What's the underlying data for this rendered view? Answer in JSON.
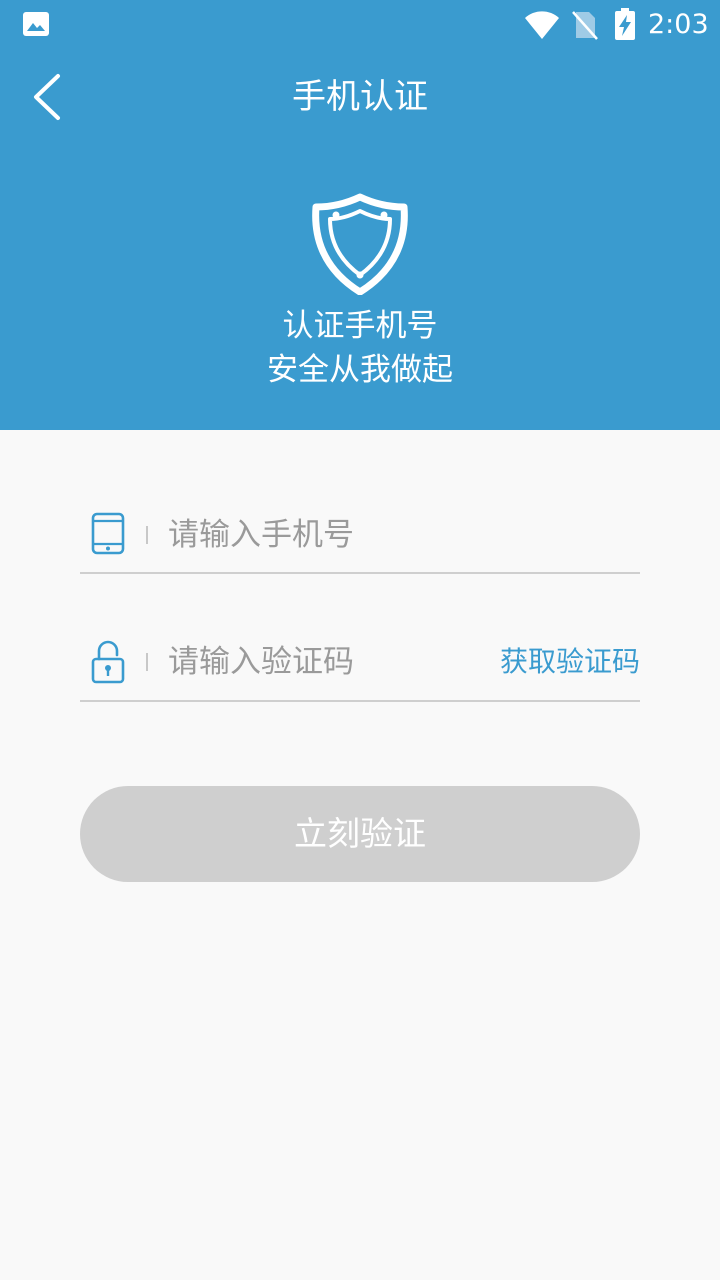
{
  "status_bar": {
    "time": "2:03",
    "icons": [
      "gallery-icon",
      "wifi-icon",
      "no-sim-icon",
      "battery-charging-icon"
    ]
  },
  "header": {
    "title": "手机认证",
    "back_icon": "chevron-left-icon",
    "shield_icon": "shield-icon",
    "slogan_line1": "认证手机号",
    "slogan_line2": "安全从我做起"
  },
  "form": {
    "phone_placeholder": "请输入手机号",
    "phone_icon": "phone-icon",
    "code_placeholder": "请输入验证码",
    "code_icon": "lock-icon",
    "get_code_label": "获取验证码",
    "submit_label": "立刻验证"
  },
  "colors": {
    "header_bg": "#3a9bcf",
    "accent": "#3a9bcf",
    "button_disabled": "#cfcfcf",
    "page_bg": "#f9f9f9"
  }
}
